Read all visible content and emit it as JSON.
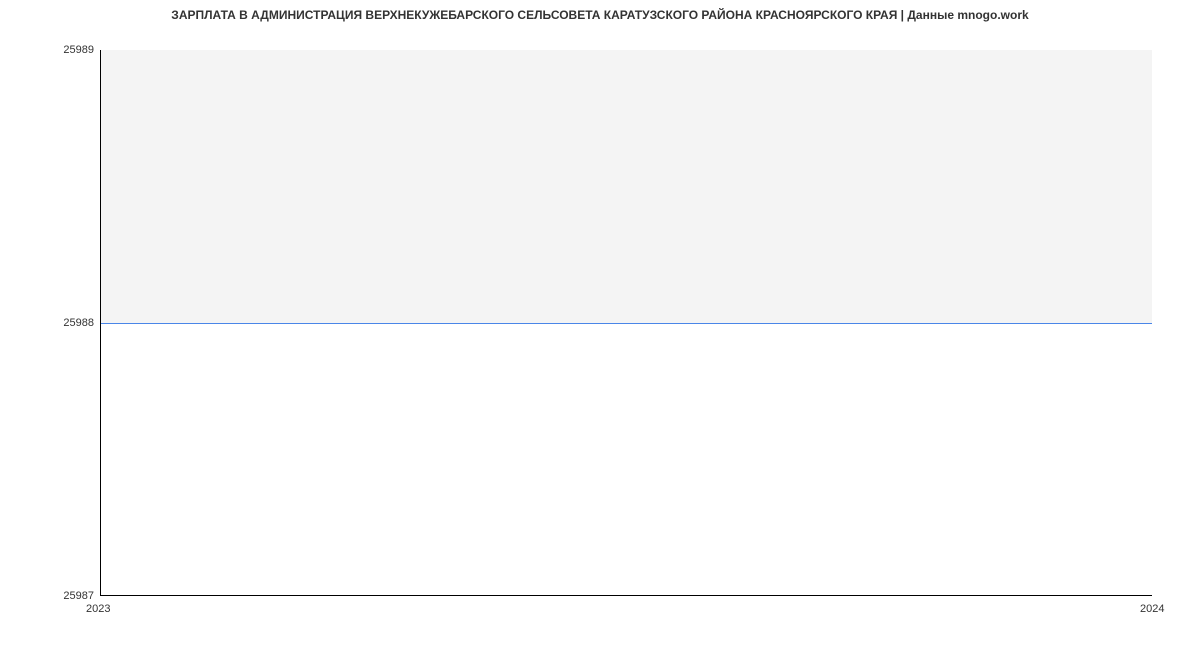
{
  "chart_data": {
    "type": "line",
    "title": "ЗАРПЛАТА В АДМИНИСТРАЦИЯ ВЕРХНЕКУЖЕБАРСКОГО СЕЛЬСОВЕТА КАРАТУЗСКОГО РАЙОНА КРАСНОЯРСКОГО КРАЯ | Данные mnogo.work",
    "x": [
      2023,
      2024
    ],
    "values": [
      25988,
      25988
    ],
    "xlabel": "",
    "ylabel": "",
    "x_ticks": [
      "2023",
      "2024"
    ],
    "y_ticks": [
      "25987",
      "25988",
      "25989"
    ],
    "xlim": [
      2023,
      2024
    ],
    "ylim": [
      25987,
      25989
    ]
  }
}
